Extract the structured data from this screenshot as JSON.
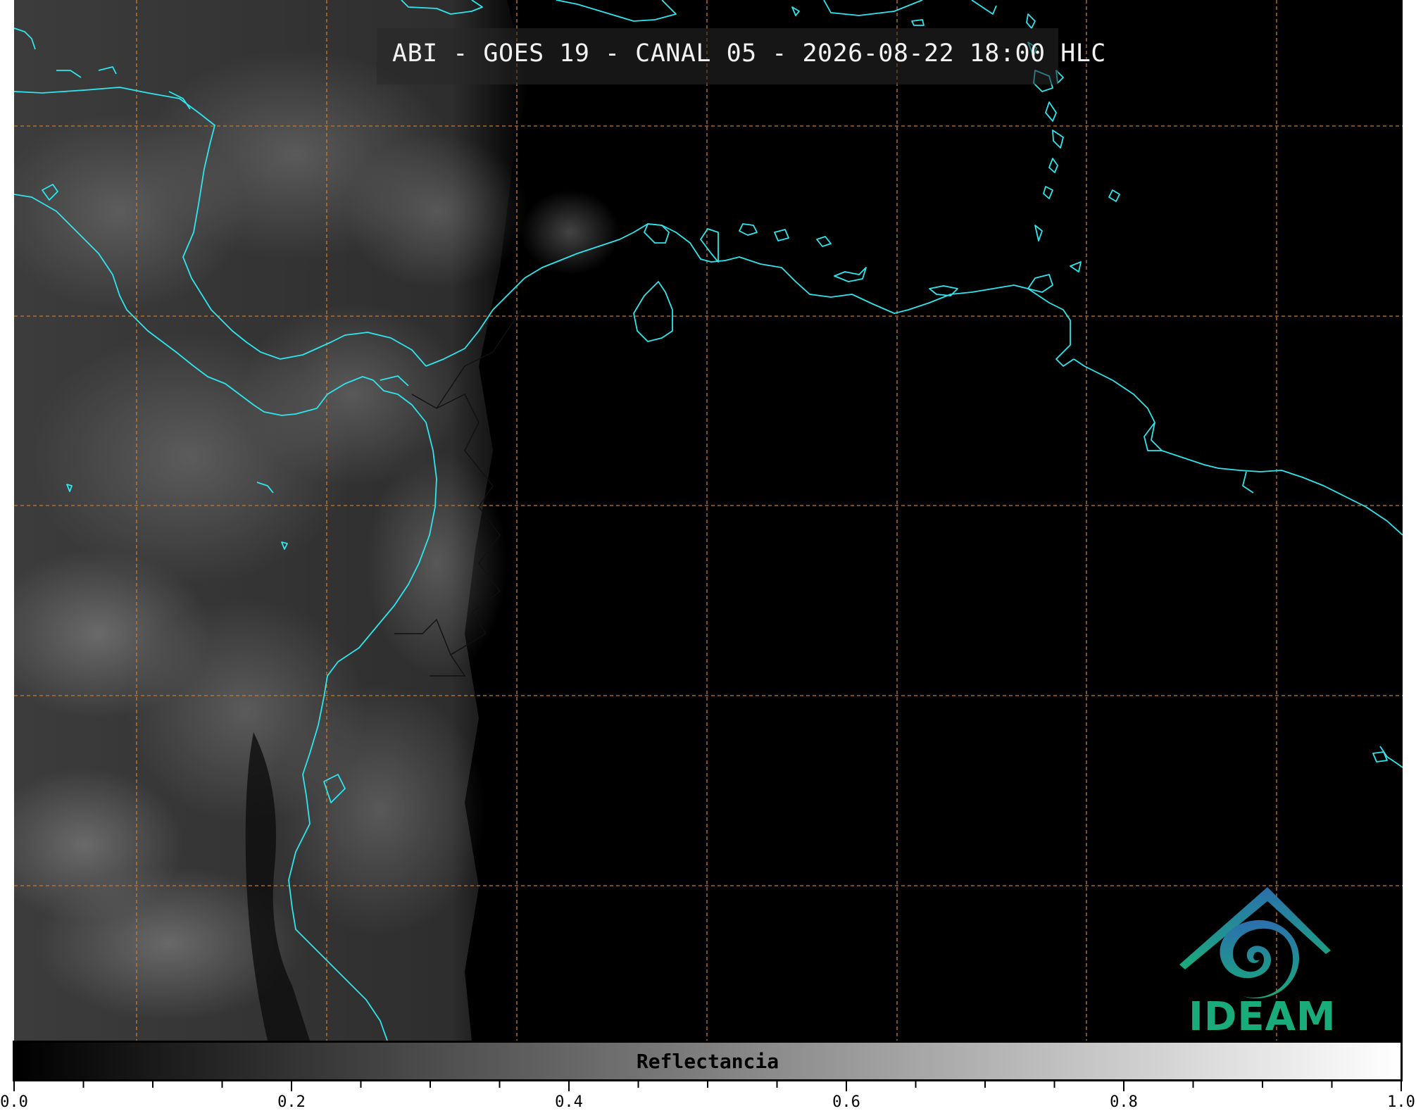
{
  "title": "ABI - GOES 19 - CANAL 05 - 2026-08-22 18:00 HLC",
  "colorbar": {
    "label": "Reflectancia",
    "min": 0.0,
    "max": 1.0,
    "tick_labels": [
      "0.0",
      "0.2",
      "0.4",
      "0.6",
      "0.8",
      "1.0"
    ],
    "minor_tick_count": 21,
    "gradient": [
      "#000000",
      "#ffffff"
    ]
  },
  "map": {
    "coastline_color": "#2ee6ee",
    "border_color": "#1b1b1b",
    "grid_color": "#c87a2e",
    "grid_style": "dashed",
    "background": "#000000"
  },
  "logo": {
    "text": "IDEAM",
    "colors": [
      "#2b6fae",
      "#1aab7a"
    ]
  }
}
